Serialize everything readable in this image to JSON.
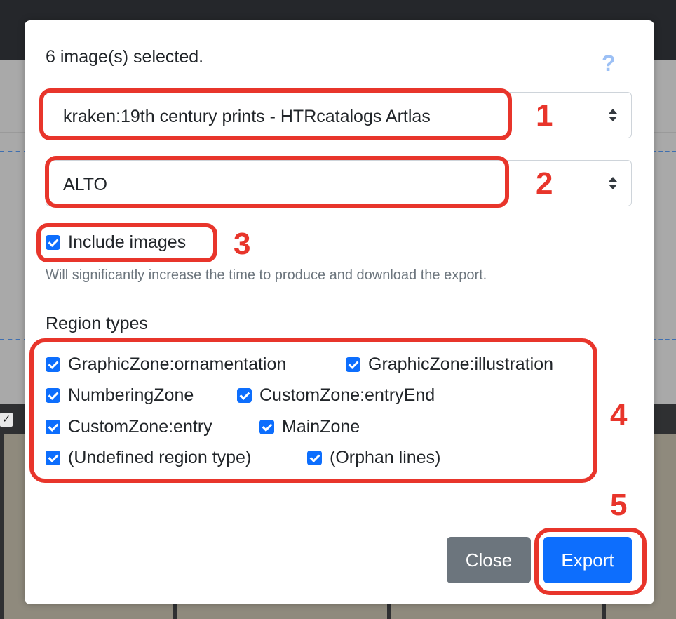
{
  "background": {
    "thumbnail_checkbox": "✓"
  },
  "modal": {
    "title": "6 image(s) selected.",
    "help_icon": "?",
    "model_select": {
      "value": "kraken:19th century prints - HTRcatalogs Artlas"
    },
    "format_select": {
      "value": "ALTO"
    },
    "include_images": {
      "label": "Include images",
      "checked": true
    },
    "include_images_hint": "Will significantly increase the time to produce and download the export.",
    "region_types_heading": "Region types",
    "region_types": [
      {
        "label": "GraphicZone:ornamentation",
        "checked": true
      },
      {
        "label": "GraphicZone:illustration",
        "checked": true
      },
      {
        "label": "NumberingZone",
        "checked": true
      },
      {
        "label": "CustomZone:entryEnd",
        "checked": true
      },
      {
        "label": "CustomZone:entry",
        "checked": true
      },
      {
        "label": "MainZone",
        "checked": true
      },
      {
        "label": "(Undefined region type)",
        "checked": true
      },
      {
        "label": "(Orphan lines)",
        "checked": true
      }
    ],
    "buttons": {
      "close": "Close",
      "export": "Export"
    }
  },
  "annotations": {
    "color": "#e8352b",
    "numbers": [
      "1",
      "2",
      "3",
      "4",
      "5"
    ]
  },
  "colors": {
    "primary": "#0d6efd",
    "secondary": "#6c757d",
    "help_icon": "#9cc0f5"
  }
}
